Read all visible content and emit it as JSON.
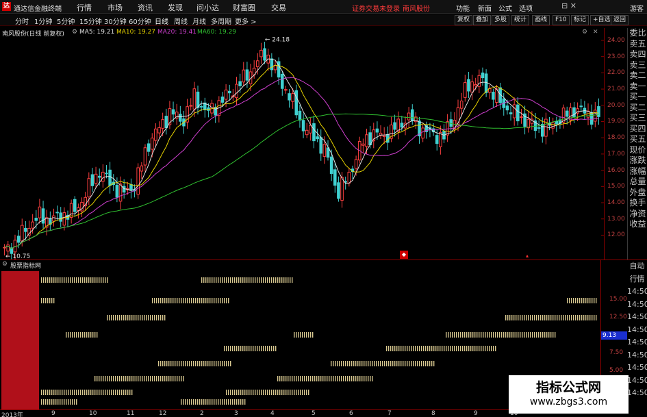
{
  "window": {
    "title": "通达信金融终端",
    "menu": [
      "行情",
      "市场",
      "资讯",
      "发现",
      "问小达",
      "财富圈",
      "交易"
    ],
    "notice": "证券交易未登录",
    "stock_link": "南风股份",
    "right_menu": [
      "功能",
      "新面",
      "公式",
      "选项"
    ],
    "window_controls": "⊟ ✕",
    "user": "游客"
  },
  "toolbar": {
    "periods": [
      "分时",
      "1分钟",
      "5分钟",
      "15分钟",
      "30分钟",
      "60分钟",
      "日线",
      "周线",
      "月线",
      "多周期",
      "更多 >"
    ],
    "active": "日线",
    "buttons": [
      "复权",
      "叠加",
      "多股",
      "统计",
      "画线",
      "F10",
      "标记",
      "+自选",
      "返回"
    ]
  },
  "chart_header": {
    "name": "南风股份(日线 前复权)",
    "ma": [
      {
        "label": "MA5: 19.21",
        "color": "#e0e0e0"
      },
      {
        "label": "MA10: 19.27",
        "color": "#e6d200"
      },
      {
        "label": "MA20: 19.41",
        "color": "#d040d0"
      },
      {
        "label": "MA60: 19.29",
        "color": "#30c030"
      }
    ]
  },
  "price_axis": [
    "24.00",
    "23.00",
    "22.00",
    "21.00",
    "20.00",
    "19.00",
    "18.00",
    "17.00",
    "16.00",
    "15.00",
    "14.00",
    "13.00",
    "12.00"
  ],
  "annotations": {
    "high": "24.18",
    "low": "10.75"
  },
  "side_labels": [
    "委比",
    "卖五",
    "卖四",
    "卖三",
    "卖二",
    "卖一",
    "买一",
    "买二",
    "买三",
    "买四",
    "买五",
    "现价",
    "涨跌",
    "涨幅",
    "总量",
    "外盘",
    "换手",
    "净资",
    "收益"
  ],
  "indicator": {
    "name": "股票指标网",
    "axis": [
      "15.00",
      "12.50",
      "10.00",
      "7.50",
      "5.00"
    ],
    "current": "9.13"
  },
  "lower_right": [
    "自动",
    "行情",
    "14:50",
    "14:50",
    "14:50",
    "14:50",
    "14:50",
    "14:50",
    "14:50",
    "14:50",
    "14:50"
  ],
  "dates": [
    "2013年",
    "9",
    "10",
    "11",
    "12",
    "2",
    "3",
    "4",
    "5",
    "6",
    "7",
    "8",
    "9",
    "10"
  ],
  "watermark": {
    "line1": "指标公式网",
    "line2": "www.zbgs3.com"
  },
  "chart_data": {
    "type": "candlestick",
    "ylim": [
      10.5,
      24.8
    ],
    "high": 24.18,
    "low": 10.75,
    "ma_latest": {
      "MA5": 19.21,
      "MA10": 19.27,
      "MA20": 19.41,
      "MA60": 19.29
    },
    "close_approx": [
      11.0,
      11.6,
      12.6,
      13.2,
      12.9,
      13.3,
      13.5,
      14.8,
      16.0,
      15.1,
      14.6,
      15.1,
      17.5,
      18.6,
      19.6,
      19.0,
      20.6,
      19.5,
      20.1,
      20.8,
      21.5,
      22.4,
      23.3,
      21.7,
      20.6,
      18.8,
      18.1,
      17.2,
      14.6,
      15.7,
      17.6,
      18.3,
      18.1,
      18.7,
      19.3,
      18.6,
      18.2,
      18.1,
      19.5,
      21.3,
      21.6,
      20.8,
      20.0,
      19.4,
      19.0,
      18.5,
      18.8,
      19.3,
      19.8,
      19.5,
      19.3
    ]
  }
}
